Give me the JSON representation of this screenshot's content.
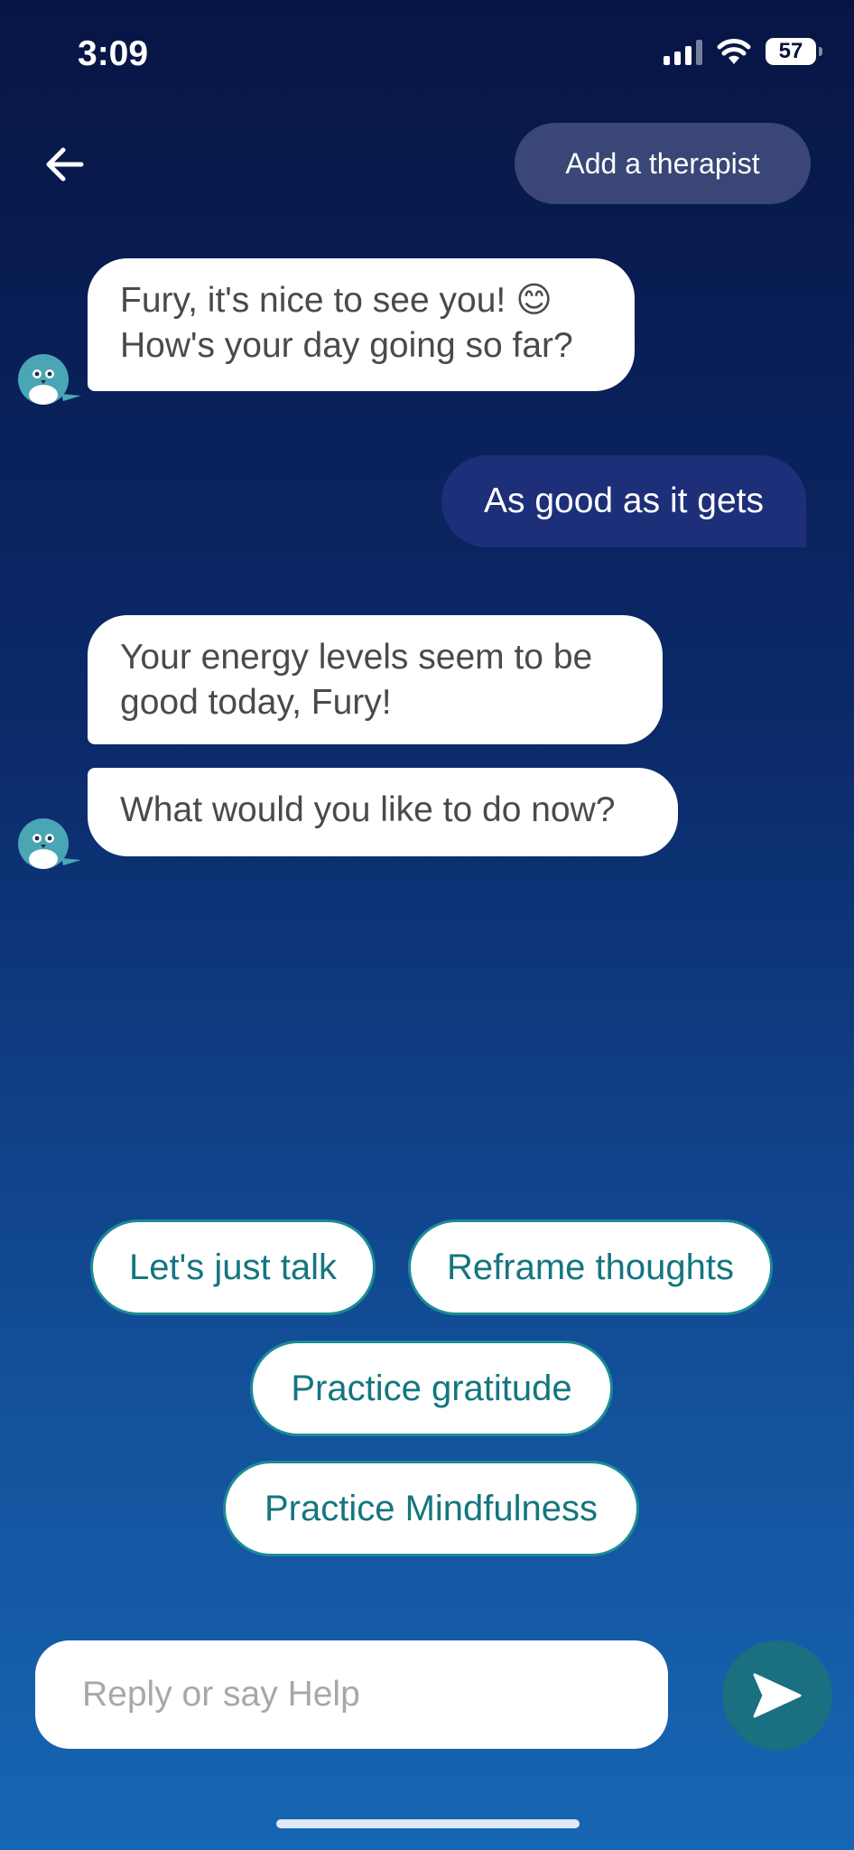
{
  "status_bar": {
    "time": "3:09",
    "battery": "57"
  },
  "header": {
    "add_therapist_label": "Add a therapist"
  },
  "messages": [
    {
      "sender": "bot",
      "line1": "Fury, it's nice to see you! 😊",
      "line2": "How's your day going so far?"
    },
    {
      "sender": "user",
      "text": "As good as it gets"
    },
    {
      "sender": "bot",
      "line1": "Your energy levels seem to be",
      "line2": "good today, Fury!"
    },
    {
      "sender": "bot",
      "text": "What would you like to do now?"
    }
  ],
  "quick_replies": [
    "Let's just talk",
    "Reframe thoughts",
    "Practice gratitude",
    "Practice Mindfulness"
  ],
  "composer": {
    "placeholder": "Reply or say Help"
  },
  "icons": [
    "back-arrow-icon",
    "signal-icon",
    "wifi-icon",
    "battery-icon",
    "send-icon",
    "bot-avatar-icon"
  ],
  "colors": {
    "chip_text": "#14767f",
    "chip_border": "#1b8c95",
    "user_bubble": "#1d2f78",
    "send_button": "#1a6f80",
    "therapist_button": "#3a4676"
  }
}
